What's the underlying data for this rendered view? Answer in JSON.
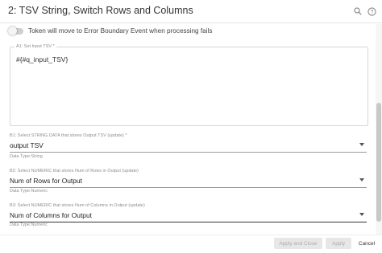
{
  "header": {
    "title": "2: TSV String, Switch Rows and Columns",
    "search_icon": "search-icon",
    "help_icon": "help-icon"
  },
  "toggle": {
    "label": "Token will move to Error Boundary Event when processing fails",
    "on": false
  },
  "a1": {
    "label": "A1: Set Input TSV *",
    "value": "#{#q_input_TSV}"
  },
  "b1": {
    "label": "B1: Select STRING DATA that stores Output TSV (update) *",
    "value": "output TSV",
    "helper": "Data Type:String"
  },
  "b2": {
    "label": "B2: Select NUMERIC that stores Num of Rows in Output (update)",
    "value": "Num of Rows for Output",
    "helper": "Data Type:Numeric"
  },
  "b3": {
    "label": "B3: Select NUMERIC that stores Num of Columns in Output (update)",
    "value": "Num of Columns for Output",
    "helper": "Data Type:Numeric"
  },
  "footer": {
    "apply_close_label": "Apply and Close",
    "apply_label": "Apply",
    "cancel_label": "Cancel"
  },
  "colors": {
    "disabled_button": "#e7e7e7",
    "underline_active": "#333333"
  }
}
